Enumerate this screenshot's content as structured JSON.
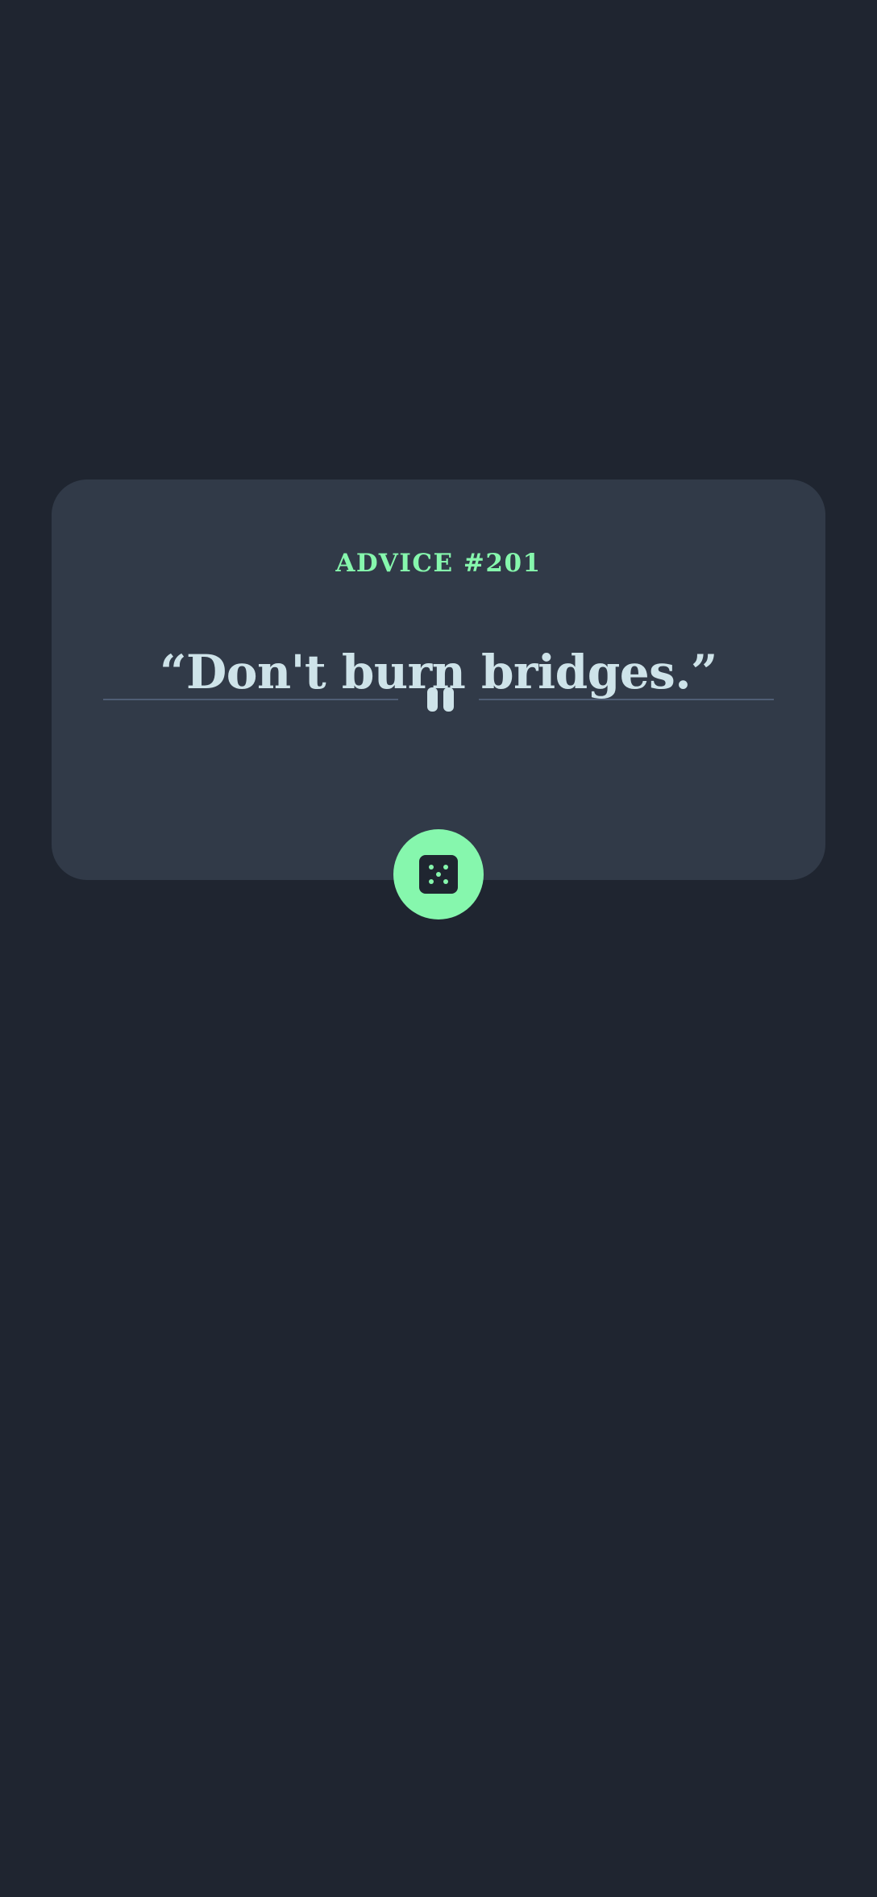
{
  "advice": {
    "label": "ADVICE #201",
    "quote": "“Don't burn bridges.”"
  },
  "icons": {
    "divider": "pause-icon",
    "button": "dice-icon"
  },
  "colors": {
    "background": "#1f2530",
    "card": "#313a48",
    "accent": "#86f7ad",
    "text": "#cee3e9",
    "divider": "#4f5d74"
  }
}
